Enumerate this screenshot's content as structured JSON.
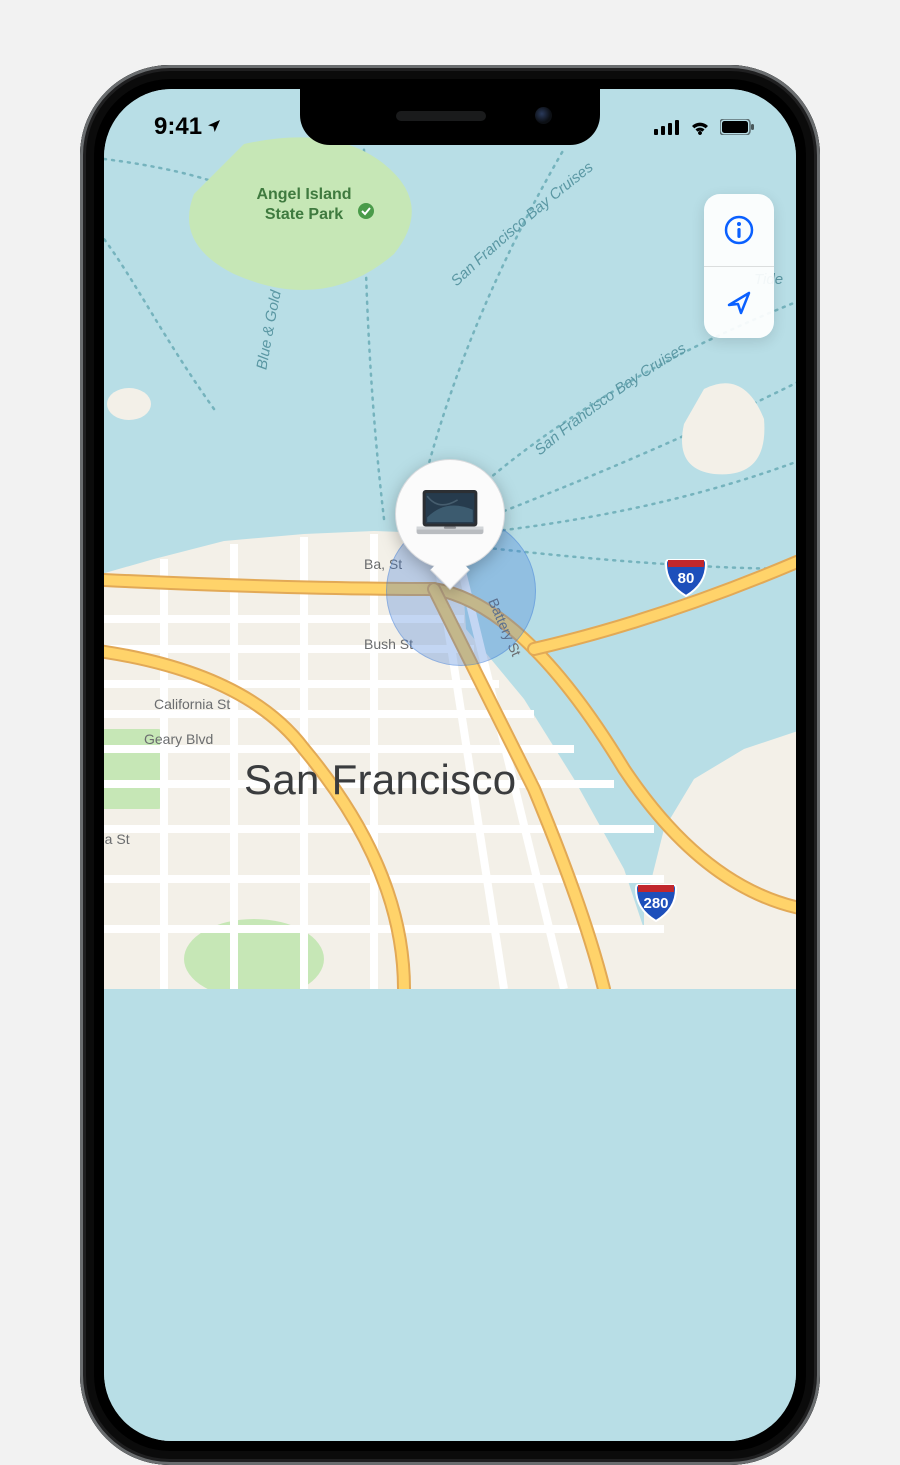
{
  "status": {
    "time": "9:41"
  },
  "controls": {
    "info": "i",
    "locate": "↗"
  },
  "map": {
    "city": "San Francisco",
    "park": {
      "line1": "Angel Island",
      "line2": "State Park"
    },
    "streets": {
      "california": "California St",
      "geary": "Geary Blvd",
      "bay": "Ba, St",
      "bush": "Bush St",
      "battery": "Battery St",
      "lboa": "lboa St"
    },
    "water_labels": {
      "bg_ferry": "Blue & Gold Ferry",
      "sf_cruises1": "San Francisco Bay Cruises",
      "sf_cruises2": "San Francisco Bay Cruises",
      "tide": "Tide"
    },
    "shields": {
      "i80": "80",
      "i280": "280"
    },
    "located_device": "MacBook Pro"
  },
  "colors": {
    "accent": "#0a60ff",
    "water": "#b8dee6",
    "land": "#f3f0e8",
    "park": "#c6e7b6",
    "highway": "#ffd36a"
  }
}
